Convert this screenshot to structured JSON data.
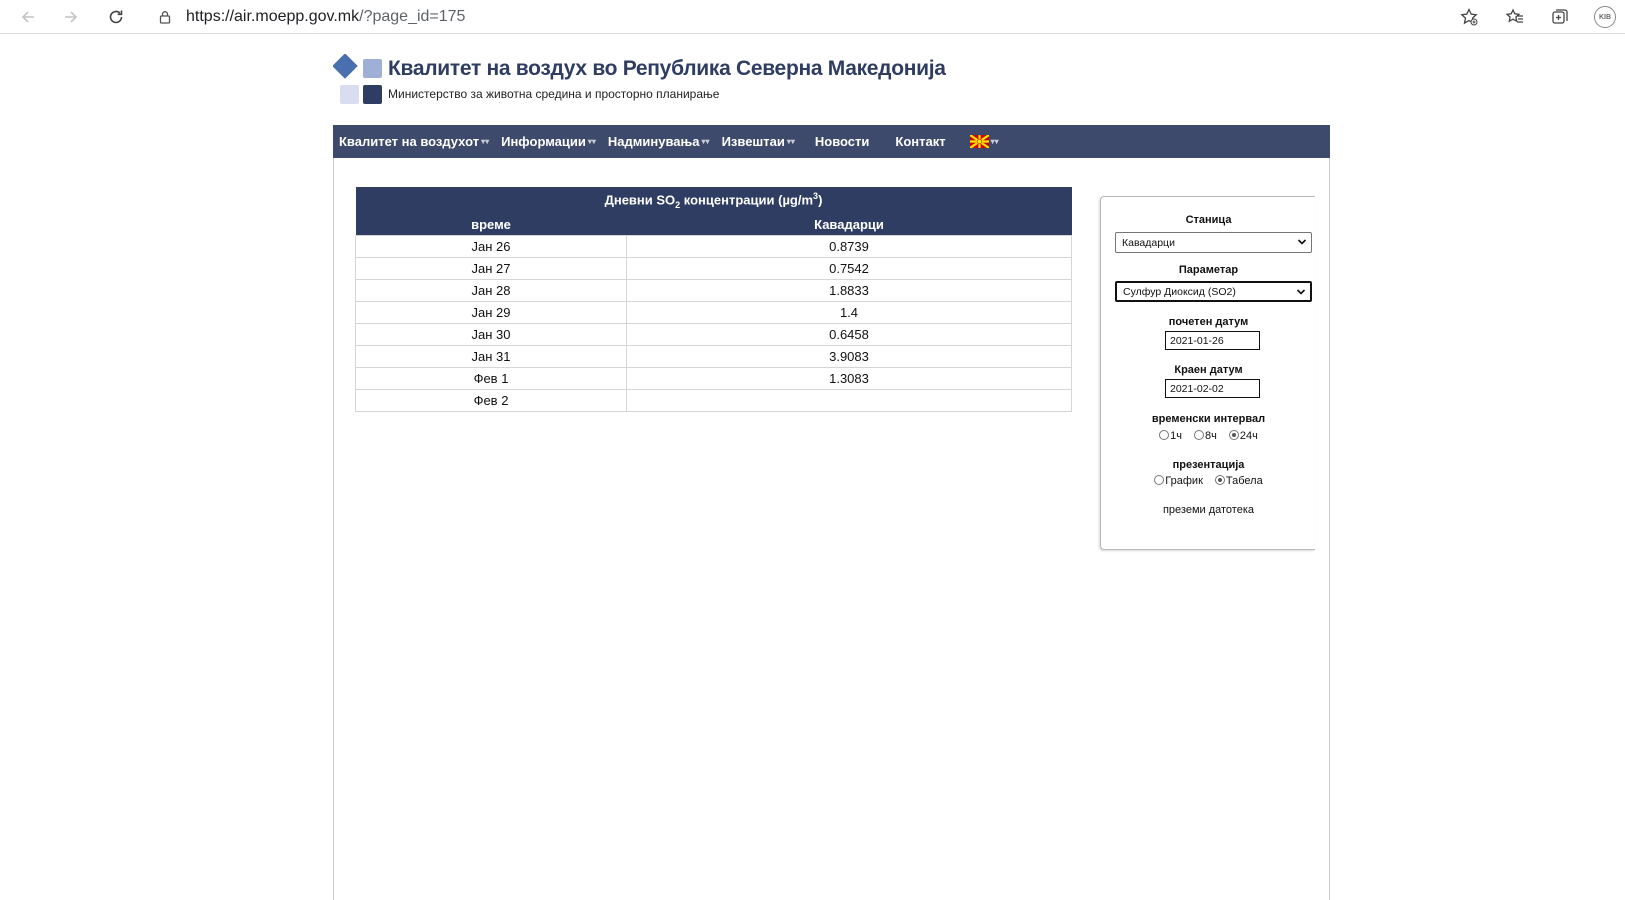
{
  "browser": {
    "url_host": "https://air.moepp.gov.mk",
    "url_rest": "/?page_id=175",
    "profile_initials": "KIB"
  },
  "header": {
    "title": "Квалитет на воздух во Република Северна Македонија",
    "subtitle": "Министерство за животна средина и просторно планирање"
  },
  "menu": {
    "items": [
      {
        "label": "Квалитет на воздухот",
        "has_dropdown": true
      },
      {
        "label": "Информации",
        "has_dropdown": true
      },
      {
        "label": "Надминувања",
        "has_dropdown": true
      },
      {
        "label": "Извештаи",
        "has_dropdown": true
      },
      {
        "label": "Новости",
        "has_dropdown": false
      },
      {
        "label": "Контакт",
        "has_dropdown": false
      }
    ],
    "bg_color": "#3e4a6b"
  },
  "table": {
    "title_prefix": "Дневни SO",
    "title_sub": "2",
    "title_mid": " концентрации (µg/m",
    "title_sup": "3",
    "title_suffix": ")",
    "columns": [
      "време",
      "Кавадарци"
    ],
    "rows": [
      {
        "time": "Јан 26",
        "value": "0.8739"
      },
      {
        "time": "Јан 27",
        "value": "0.7542"
      },
      {
        "time": "Јан 28",
        "value": "1.8833"
      },
      {
        "time": "Јан 29",
        "value": "1.4"
      },
      {
        "time": "Јан 30",
        "value": "0.6458"
      },
      {
        "time": "Јан 31",
        "value": "3.9083"
      },
      {
        "time": "Фев 1",
        "value": "1.3083"
      },
      {
        "time": "Фев 2",
        "value": ""
      }
    ],
    "header_color": "#2f3d62"
  },
  "panel": {
    "station_label": "Станица",
    "station_value": "Кавадарци",
    "parameter_label": "Параметар",
    "parameter_value": "Сулфур Диоксид (SO2)",
    "start_label": "почетен датум",
    "start_value": "2021-01-26",
    "end_label": "Краен датум",
    "end_value": "2021-02-02",
    "interval_label": "временски интервал",
    "interval_options": [
      {
        "label": "1ч",
        "selected": false
      },
      {
        "label": "8ч",
        "selected": false
      },
      {
        "label": "24ч",
        "selected": true
      }
    ],
    "presentation_label": "презентација",
    "presentation_options": [
      {
        "label": "График",
        "selected": false
      },
      {
        "label": "Табела",
        "selected": true
      }
    ],
    "download_label": "преземи датотека"
  }
}
